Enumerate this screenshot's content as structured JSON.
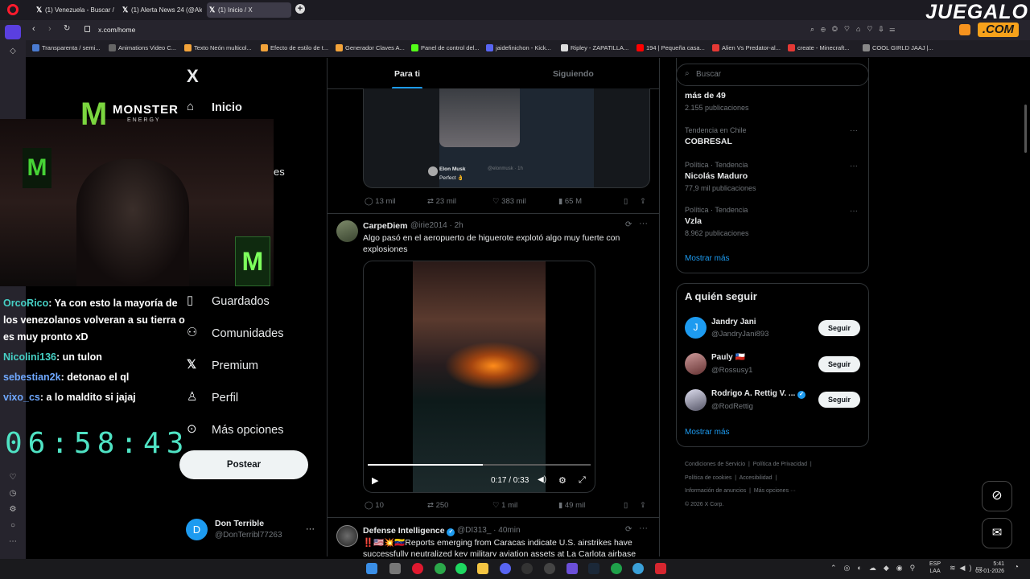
{
  "browser": {
    "tabs": [
      {
        "label": "(1) Venezuela - Buscar / X"
      },
      {
        "label": "(1) Alerta News 24 (@Aler"
      },
      {
        "label": "(1) Inicio / X"
      }
    ],
    "new_tab": "+",
    "url": "x.com/home",
    "bookmarks": [
      {
        "label": "Transparenta / semi...",
        "color": "#4a7bd0"
      },
      {
        "label": "Animations Video C...",
        "color": "#666"
      },
      {
        "label": "Texto Neón multicol...",
        "color": "#f2a33a"
      },
      {
        "label": "Efecto de estilo de t...",
        "color": "#f2a33a"
      },
      {
        "label": "Generador Claves A...",
        "color": "#f2a33a"
      },
      {
        "label": "Panel de control del...",
        "color": "#53fc18"
      },
      {
        "label": "jaidefinichon - Kick...",
        "color": "#5865f2"
      },
      {
        "label": "Ripley - ZAPATILLA...",
        "color": "#ddd"
      },
      {
        "label": "194 | Pequeña casa...",
        "color": "#ff0000"
      },
      {
        "label": "Alien Vs Predator-al...",
        "color": "#e53935"
      },
      {
        "label": "create - Minecraft...",
        "color": "#e53935"
      },
      {
        "label": "COOL GIRLD JAAJ |...",
        "color": "#888"
      }
    ]
  },
  "watermark": {
    "line1": "JUEGALO",
    "line2": ".COM"
  },
  "x": {
    "logo": "X",
    "nav": {
      "inicio": "Inicio",
      "explorar_fragment": "es",
      "guardados": "Guardados",
      "comunidades": "Comunidades",
      "premium": "Premium",
      "perfil": "Perfil",
      "mas_opciones": "Más opciones",
      "postear": "Postear"
    },
    "account": {
      "name": "Don Terrible",
      "handle": "@DonTerribl77263",
      "initial": "D",
      "more": "···"
    },
    "feed_tabs": {
      "for_you": "Para ti",
      "following": "Siguiendo"
    },
    "tweet0": {
      "embed_name": "Elon Musk",
      "embed_handle": "@elonmusk · 1h",
      "embed_text": "Perfect 👌",
      "replies": "13 mil",
      "reposts": "23 mil",
      "likes": "383 mil",
      "views": "65 M"
    },
    "tweet1": {
      "name": "CarpeDiem",
      "handle": "@irie2014 · 2h",
      "text": "Algo pasó en el aeropuerto de higuerote explotó algo muy fuerte con explosiones",
      "video_time": "0:17 / 0:33",
      "video_progress": 0.515,
      "replies": "10",
      "reposts": "250",
      "likes": "1 mil",
      "views": "49 mil"
    },
    "tweet2": {
      "name": "Defense Intelligence",
      "handle": "@DI313_ · 40min",
      "text": "‼️🇺🇸💥🇻🇪Reports emerging from Caracas indicate U.S. airstrikes have successfully neutralized key military aviation assets at La Carlota airbase"
    },
    "search": {
      "placeholder": "Buscar"
    },
    "trends": [
      {
        "meta": "",
        "name": "más de 49",
        "count": "2.155 publicaciones"
      },
      {
        "meta": "Tendencia en Chile",
        "name": "COBRESAL",
        "count": ""
      },
      {
        "meta": "Política · Tendencia",
        "name": "Nicolás Maduro",
        "count": "77,9 mil publicaciones"
      },
      {
        "meta": "Política · Tendencia",
        "name": "Vzla",
        "count": "8.962 publicaciones"
      }
    ],
    "show_more": "Mostrar más",
    "who_to_follow": {
      "title": "A quién seguir",
      "users": [
        {
          "name": "Jandry Jani",
          "handle": "@JandryJani893",
          "initial": "J",
          "button": "Seguir"
        },
        {
          "name": "Pauly 🇨🇱",
          "handle": "@Rossusy1",
          "initial": "P",
          "button": "Seguir"
        },
        {
          "name": "Rodrigo A. Rettig V. ...",
          "handle": "@RodRettig",
          "initial": "R",
          "button": "Seguir"
        }
      ],
      "show_more": "Mostrar más"
    },
    "footer": {
      "links1": [
        "Condiciones de Servicio",
        "Política de Privacidad"
      ],
      "links2": [
        "Política de cookies",
        "Accesibilidad"
      ],
      "links3": [
        "Información de anuncios",
        "Más opciones ···"
      ],
      "copyright": "© 2026 X Corp."
    }
  },
  "stream_overlay": {
    "chat": [
      {
        "user": "OrcoRico",
        "text": ": Ya con esto la mayoría de"
      },
      {
        "user": "",
        "text": "los venezolanos volveran a su tierra o"
      },
      {
        "user": "",
        "text": "es muy pronto xD"
      },
      {
        "user": "Nicolini136",
        "text": ": un tulon"
      },
      {
        "user": "sebestian2k",
        "text": ": detonao el ql"
      },
      {
        "user": "vixo_cs",
        "text": ": a lo maldito si jajaj"
      }
    ],
    "timer": "06:58:43",
    "monster_text": "MONSTER",
    "monster_sub": "ENERGY"
  },
  "taskbar": {
    "lang": "ESP",
    "lang2": "LAA",
    "time": "5:41",
    "date": "03-01-2026"
  }
}
